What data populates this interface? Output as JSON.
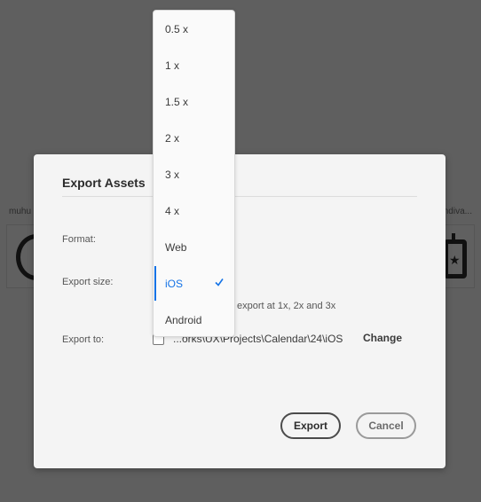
{
  "backdrop": {
    "left_label": "muhu",
    "right_label": "ndiva..."
  },
  "dialog": {
    "title": "Export Assets",
    "format_label": "Format:",
    "export_size_label": "Export size:",
    "hint": "export at 1x, 2x and 3x",
    "export_to_label": "Export to:",
    "path": "...orks\\UX\\Projects\\Calendar\\24\\iOS",
    "change_label": "Change",
    "export_button": "Export",
    "cancel_button": "Cancel"
  },
  "dropdown": {
    "items": [
      "0.5 x",
      "1 x",
      "1.5 x",
      "2 x",
      "3 x",
      "4 x",
      "Web",
      "iOS",
      "Android"
    ],
    "selected": "iOS"
  },
  "colors": {
    "accent": "#1473e6",
    "overlay": "#5f5f5f",
    "dialog_bg": "#f4f4f4"
  }
}
